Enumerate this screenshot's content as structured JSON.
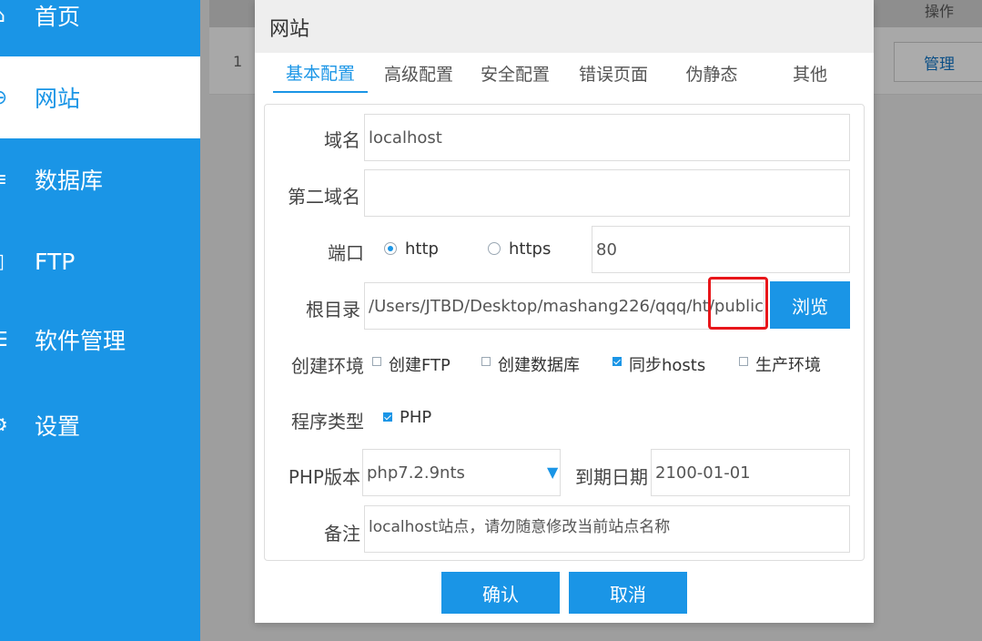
{
  "sidebar": {
    "items": [
      {
        "label": "首页",
        "icon": "home-icon"
      },
      {
        "label": "网站",
        "icon": "globe-icon"
      },
      {
        "label": "数据库",
        "icon": "database-icon"
      },
      {
        "label": "FTP",
        "icon": "ftp-icon"
      },
      {
        "label": "软件管理",
        "icon": "list-icon"
      },
      {
        "label": "设置",
        "icon": "gear-icon"
      }
    ],
    "active": "网站"
  },
  "background": {
    "column_operation": "操作",
    "row_number": "1",
    "manage_button": "管理"
  },
  "modal": {
    "title": "网站",
    "tabs": [
      "基本配置",
      "高级配置",
      "安全配置",
      "错误页面",
      "伪静态",
      "其他"
    ],
    "active_tab": "基本配置",
    "form": {
      "domain_label": "域名",
      "domain_value": "localhost",
      "second_domain_label": "第二域名",
      "second_domain_value": "",
      "port_label": "端口",
      "protocol_http": "http",
      "protocol_https": "https",
      "protocol_selected": "http",
      "port_value": "80",
      "root_label": "根目录",
      "root_value": "/Users/JTBD/Desktop/mashang226/qqq/ht/public",
      "browse_button": "浏览",
      "env_label": "创建环境",
      "env_options": [
        {
          "label": "创建FTP",
          "checked": false
        },
        {
          "label": "创建数据库",
          "checked": false
        },
        {
          "label": "同步hosts",
          "checked": true
        },
        {
          "label": "生产环境",
          "checked": false
        }
      ],
      "program_label": "程序类型",
      "program_option": {
        "label": "PHP",
        "checked": true
      },
      "php_version_label": "PHP版本",
      "php_version_value": "php7.2.9nts",
      "expire_label": "到期日期",
      "expire_value": "2100-01-01",
      "note_label": "备注",
      "note_value": "localhost站点，请勿随意修改当前站点名称"
    },
    "confirm_button": "确认",
    "cancel_button": "取消"
  },
  "colors": {
    "accent": "#1a95e6",
    "highlight": "#e8161a"
  }
}
